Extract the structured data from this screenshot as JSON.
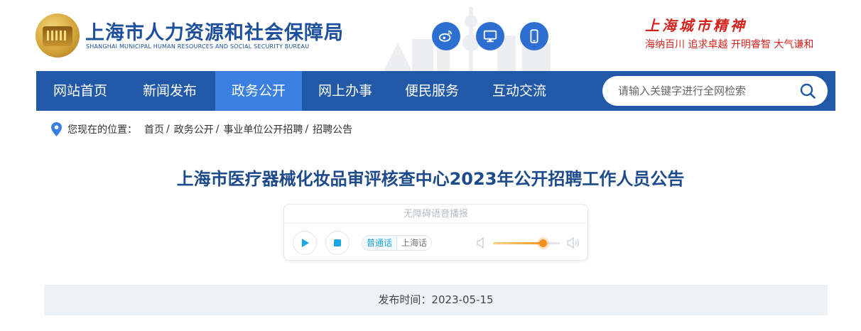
{
  "header": {
    "site_title": "上海市人力资源和社会保障局",
    "site_subtitle": "SHANGHAI MUNICIPAL HUMAN RESOURCES AND SOCIAL SECURITY BUREAU",
    "slogan_title": "上海城市精神",
    "slogan_text": "海纳百川  追求卓越  开明睿智  大气谦和",
    "icons": [
      "weibo-icon",
      "monitor-icon",
      "mobile-icon"
    ],
    "brand_color": "#2158a8"
  },
  "nav": {
    "items": [
      {
        "label": "网站首页"
      },
      {
        "label": "新闻发布"
      },
      {
        "label": "政务公开"
      },
      {
        "label": "网上办事"
      },
      {
        "label": "便民服务"
      },
      {
        "label": "互动交流"
      }
    ],
    "active_index": 2,
    "search_placeholder": "请输入关键字进行全网检索"
  },
  "breadcrumb": {
    "label": "您现在的位置：",
    "items": [
      "首页",
      "政务公开",
      "事业单位公开招聘",
      "招聘公告"
    ],
    "separator": "/"
  },
  "article": {
    "title": "上海市医疗器械化妆品审评核查中心2023年公开招聘工作人员公告",
    "publish_label": "发布时间：",
    "publish_date": "2023-05-15",
    "publish_text": "发布时间：2023-05-15"
  },
  "player": {
    "title": "无障碍语音播报",
    "languages": [
      "普通话",
      "上海话"
    ],
    "active_language": "普通话",
    "volume_fraction": 0.74,
    "accent_color": "#1aa6e0"
  }
}
